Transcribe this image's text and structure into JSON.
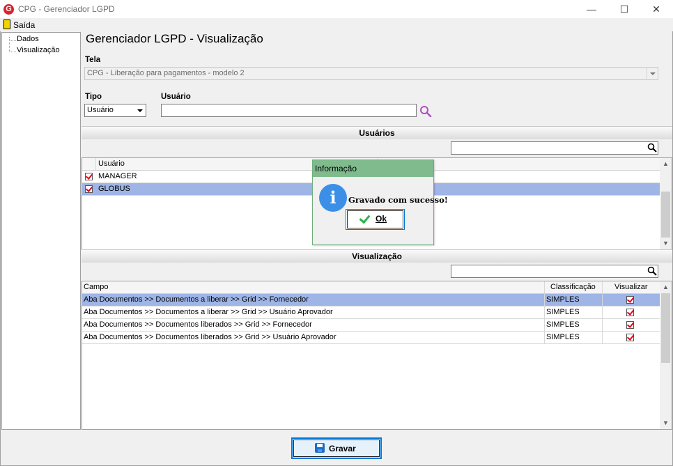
{
  "window": {
    "logo_letter": "G",
    "title": "CPG - Gerenciador LGPD",
    "minimize": "—",
    "maximize": "☐",
    "close": "✕"
  },
  "menu": {
    "exit_label": "Saída"
  },
  "tree": {
    "items": [
      "Dados",
      "Visualização"
    ]
  },
  "form": {
    "page_title": "Gerenciador LGPD - Visualização",
    "tela_label": "Tela",
    "tela_value": "CPG - Liberação para pagamentos - modelo 2",
    "tipo_label": "Tipo",
    "tipo_value": "Usuário",
    "usuario_label": "Usuário",
    "usuario_value": ""
  },
  "usuarios": {
    "header": "Usuários",
    "filter_value": "",
    "column": "Usuário",
    "rows": [
      {
        "name": "MANAGER",
        "checked": true,
        "selected": false
      },
      {
        "name": "GLOBUS",
        "checked": true,
        "selected": true
      }
    ]
  },
  "visualizacao": {
    "header": "Visualização",
    "filter_value": "",
    "columns": [
      "Campo",
      "Classificação",
      "Visualizar"
    ],
    "rows": [
      {
        "campo": "Aba Documentos >> Documentos a liberar >> Grid >> Fornecedor",
        "classificacao": "SIMPLES",
        "visualizar": true,
        "selected": true
      },
      {
        "campo": "Aba Documentos >> Documentos a liberar >> Grid >> Usuário Aprovador",
        "classificacao": "SIMPLES",
        "visualizar": true,
        "selected": false
      },
      {
        "campo": "Aba Documentos >> Documentos liberados >> Grid >> Fornecedor",
        "classificacao": "SIMPLES",
        "visualizar": true,
        "selected": false
      },
      {
        "campo": "Aba Documentos >> Documentos liberados >> Grid >> Usuário Aprovador",
        "classificacao": "SIMPLES",
        "visualizar": true,
        "selected": false
      }
    ]
  },
  "buttons": {
    "gravar": "Gravar"
  },
  "dialog": {
    "title": "Informação",
    "icon_letter": "i",
    "message": "Gravado com sucesso!",
    "ok": "Ok"
  },
  "colors": {
    "selection": "#9eb5e6",
    "dialog_title": "#7fbb8d",
    "check_red": "#e0001a",
    "accent_blue": "#0078d7",
    "search_purple": "#b04fc4"
  }
}
